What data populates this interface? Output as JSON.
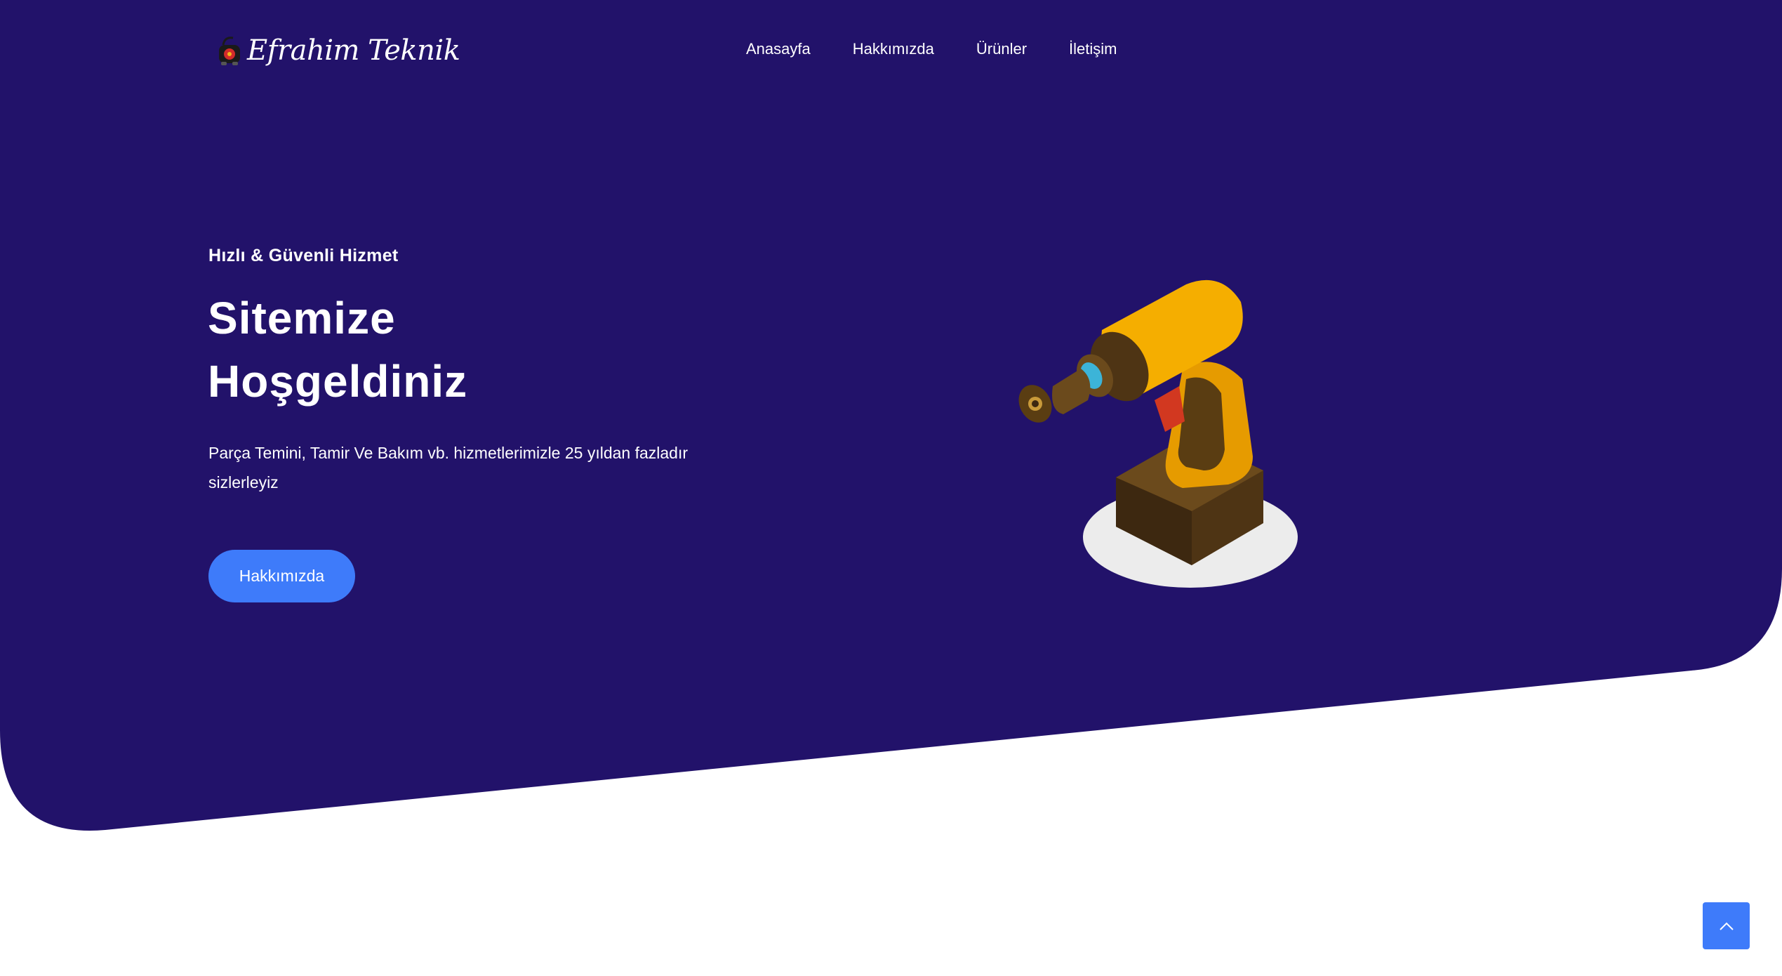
{
  "brand": {
    "name": "Efrahim Teknik",
    "logo_icon": "vacuum-cleaner-icon"
  },
  "nav": {
    "items": [
      {
        "label": "Anasayfa"
      },
      {
        "label": "Hakkımızda"
      },
      {
        "label": "Ürünler"
      },
      {
        "label": "İletişim"
      }
    ]
  },
  "hero": {
    "tagline": "Hızlı & Güvenli Hizmet",
    "title_line1": "Sitemize",
    "title_line2": "Hoşgeldiniz",
    "description": "Parça Temini, Tamir Ve Bakım vb. hizmetlerimizle 25 yıldan fazladır sizlerleyiz",
    "cta_label": "Hakkımızda",
    "illustration_icon": "cordless-drill-icon"
  },
  "scroll_top": {
    "icon": "chevron-up-icon"
  },
  "colors": {
    "hero_background": "#22126a",
    "accent": "#3e7bfa",
    "text": "#ffffff",
    "page_background": "#ffffff"
  }
}
